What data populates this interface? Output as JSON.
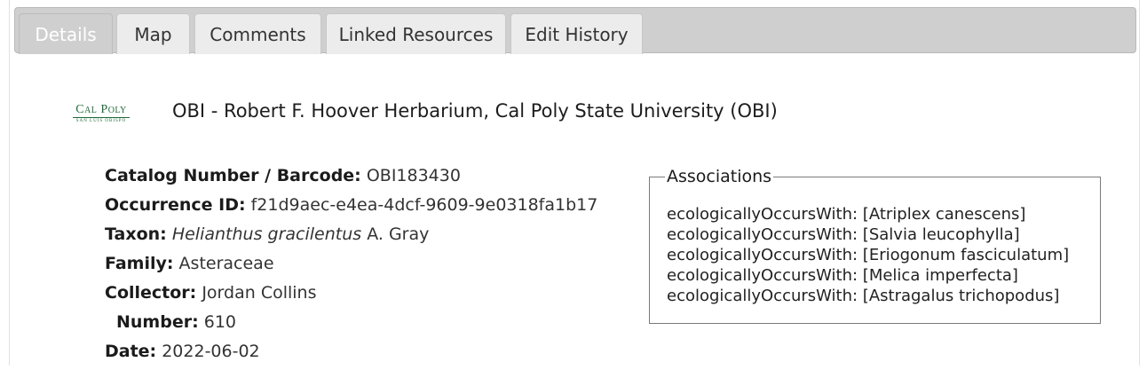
{
  "tabs": [
    {
      "label": "Details",
      "active": true
    },
    {
      "label": "Map",
      "active": false
    },
    {
      "label": "Comments",
      "active": false
    },
    {
      "label": "Linked Resources",
      "active": false
    },
    {
      "label": "Edit History",
      "active": false
    }
  ],
  "logo": {
    "main": "Cal Poly",
    "sub": "SAN LUIS OBISPO",
    "color": "#1f6b3a"
  },
  "institution": {
    "title": "OBI - Robert F. Hoover Herbarium, Cal Poly State University (OBI)"
  },
  "record": {
    "catalog_label": "Catalog Number / Barcode:",
    "catalog_value": "OBI183430",
    "occurrence_label": "Occurrence ID:",
    "occurrence_value": "f21d9aec-e4ea-4dcf-9609-9e0318fa1b17",
    "taxon_label": "Taxon:",
    "taxon_name": "Helianthus gracilentus",
    "taxon_author": "A. Gray",
    "family_label": "Family:",
    "family_value": "Asteraceae",
    "collector_label": "Collector:",
    "collector_value": "Jordan Collins",
    "number_label": "Number:",
    "number_value": "610",
    "date_label": "Date:",
    "date_value": "2022-06-02"
  },
  "associations": {
    "legend": "Associations",
    "items": [
      "ecologicallyOccursWith: [Atriplex canescens]",
      "ecologicallyOccursWith: [Salvia leucophylla]",
      "ecologicallyOccursWith: [Eriogonum fasciculatum]",
      "ecologicallyOccursWith: [Melica imperfecta]",
      "ecologicallyOccursWith: [Astragalus trichopodus]"
    ]
  }
}
